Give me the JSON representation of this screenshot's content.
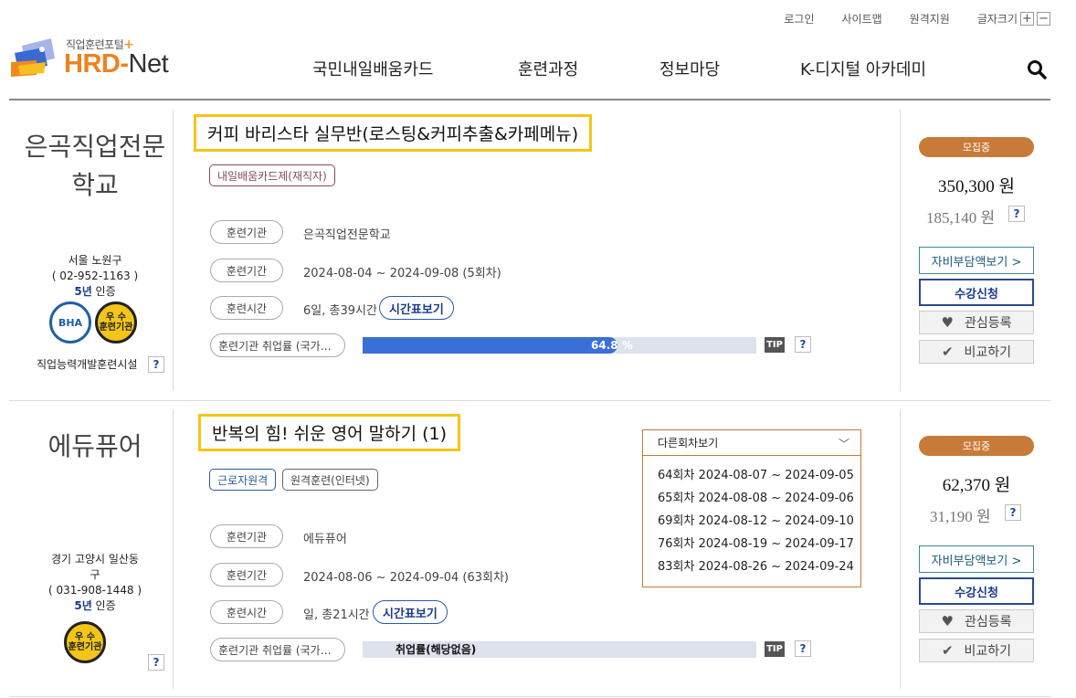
{
  "header": {
    "util": {
      "login": "로그인",
      "sitemap": "사이트맵",
      "remote": "원격지원",
      "font_size": "글자크기",
      "plus": "+",
      "minus": "−"
    },
    "logo": {
      "sub": "직업훈련포털",
      "plus_mark": "+",
      "hrd": "HRD",
      "dash": "-",
      "net": "Net"
    },
    "nav": [
      "국민내일배움카드",
      "훈련과정",
      "정보마당",
      "K-디지털 아카데미"
    ]
  },
  "courses": [
    {
      "institution": "은곡직업전문학교",
      "location": "서울 노원구",
      "phone": "( 02-952-1163 )",
      "cert_years": "5년",
      "cert_suffix": " 인증",
      "badges": {
        "bha": "BHA",
        "excellent_line1": "우 수",
        "excellent_line2": "훈련기관"
      },
      "facility_label": "직업능력개발훈련시설",
      "help": "?",
      "title": "커피 바리스타 실무반(로스팅&커피추출&카페메뉴)",
      "tags": [
        "내일배움카드제(재직자)"
      ],
      "labels": {
        "org": "훈련기관",
        "period": "훈련기간",
        "time": "훈련시간",
        "employ": "훈련기관 취업률 (국가…"
      },
      "org": "은곡직업전문학교",
      "period": "2024-08-04 ~ 2024-09-08 (5회차)",
      "time": "6일, 총39시간",
      "timetable_btn": "시간표보기",
      "employment_rate_text": "64.8 %",
      "employment_rate": 0.648,
      "tip": "TIP",
      "status": "모집중",
      "price": "350,300 원",
      "self_pay": "185,140 원",
      "btn_self_pay": "자비부담액보기 >",
      "btn_apply": "수강신청",
      "btn_interest": "관심등록",
      "btn_compare": "비교하기"
    },
    {
      "institution": "에듀퓨어",
      "location": "경기 고양시 일산동구",
      "phone": "( 031-908-1448 )",
      "cert_years": "5년",
      "cert_suffix": " 인증",
      "badges": {
        "excellent_line1": "우 수",
        "excellent_line2": "훈련기관"
      },
      "help": "?",
      "title": "반복의 힘! 쉬운 영어 말하기 (1)",
      "tags": [
        "근로자원격",
        "원격훈련(인터넷)"
      ],
      "labels": {
        "org": "훈련기관",
        "period": "훈련기간",
        "time": "훈련시간",
        "employ": "훈련기관 취업률 (국가…"
      },
      "org": "에듀퓨어",
      "period": "2024-08-06 ~ 2024-09-04 (63회차)",
      "time": "일, 총21시간",
      "timetable_btn": "시간표보기",
      "employment_rate_text": "취업률(해당없음)",
      "tip": "TIP",
      "other_sessions": {
        "label": "다른회차보기",
        "items": [
          "64회차 2024-08-07 ~ 2024-09-05",
          "65회차 2024-08-08 ~ 2024-09-06",
          "69회차 2024-08-12 ~ 2024-09-10",
          "76회차 2024-08-19 ~ 2024-09-17",
          "83회차 2024-08-26 ~ 2024-09-24"
        ]
      },
      "status": "모집중",
      "price": "62,370 원",
      "self_pay": "31,190 원",
      "btn_self_pay": "자비부담액보기 >",
      "btn_apply": "수강신청",
      "btn_interest": "관심등록",
      "btn_compare": "비교하기"
    }
  ]
}
